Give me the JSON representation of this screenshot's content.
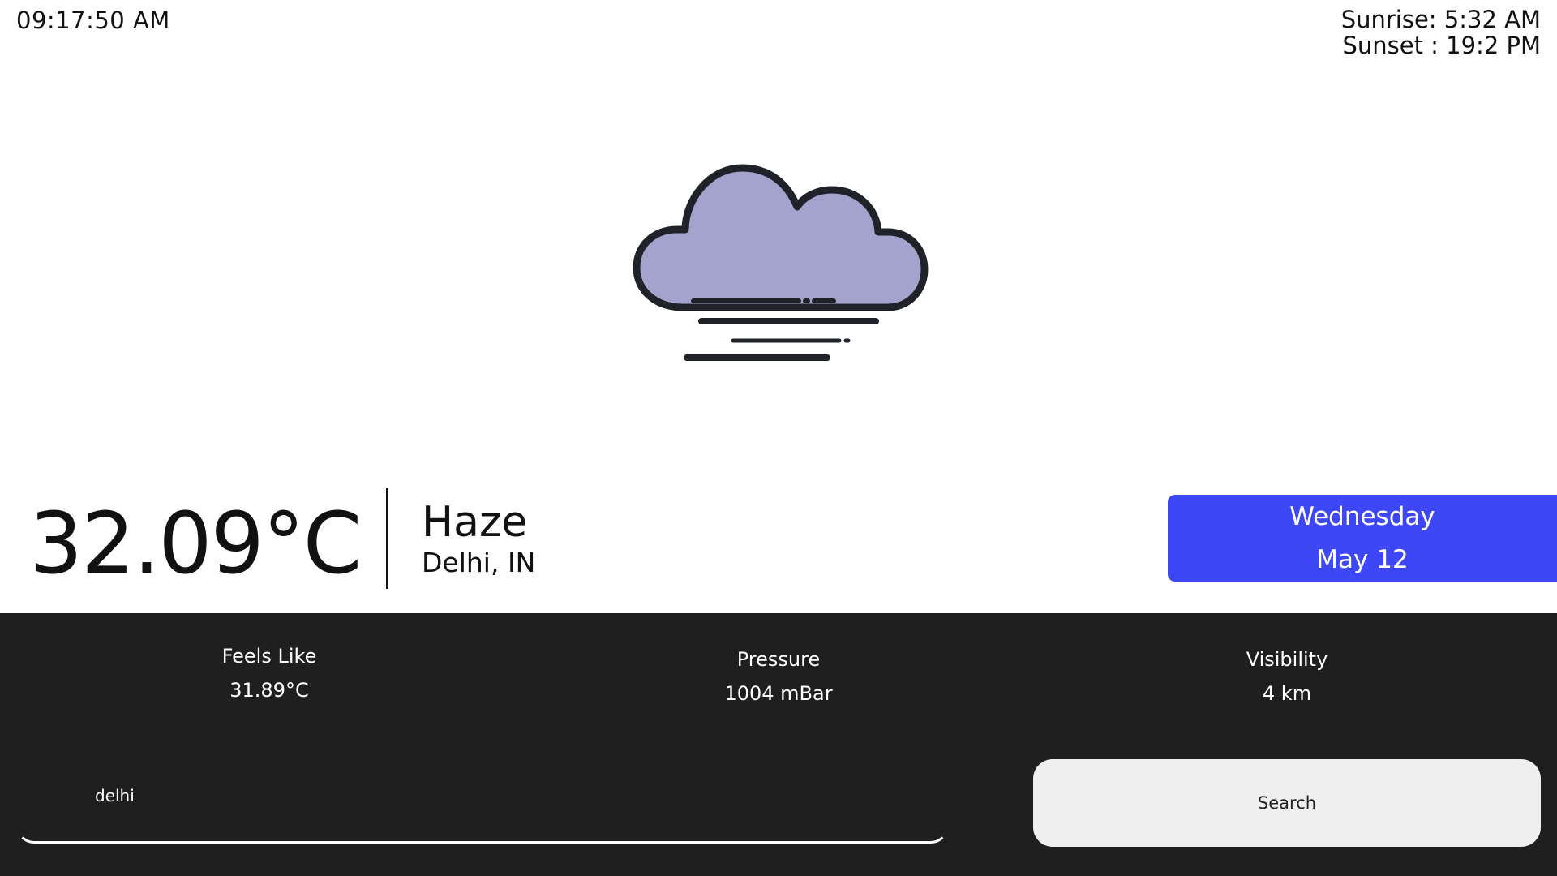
{
  "header": {
    "clock": "09:17:50 AM",
    "sunrise": "Sunrise: 5:32 AM",
    "sunset": "Sunset : 19:2 PM"
  },
  "weather": {
    "icon": "haze-cloud-icon",
    "temperature": "32.09°C",
    "condition": "Haze",
    "location": "Delhi, IN"
  },
  "date_card": {
    "day": "Wednesday",
    "date": "May 12"
  },
  "stats": [
    {
      "label": "Feels Like",
      "value": "31.89°C"
    },
    {
      "label": "Pressure",
      "value": "1004 mBar"
    },
    {
      "label": "Visibility",
      "value": "4 km"
    }
  ],
  "search": {
    "value": "delhi",
    "button_label": "Search"
  },
  "colors": {
    "accent": "#3d47f5",
    "panel": "#1f1f1f",
    "cloud_fill": "#a3a3cd",
    "cloud_stroke": "#1f2329"
  }
}
